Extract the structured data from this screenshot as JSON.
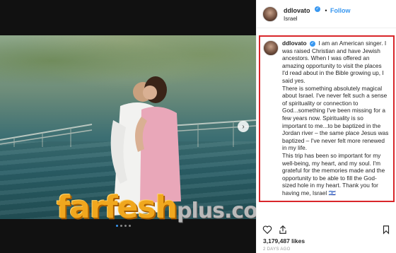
{
  "post": {
    "username": "ddlovato",
    "follow_label": "Follow",
    "separator": "•",
    "location": "Israel",
    "caption_username": "ddlovato",
    "caption_paragraphs": [
      "I am an American singer. I was raised Christian and have Jewish ancestors. When I was offered an amazing opportunity to visit the places I'd read about in the Bible growing up, I said yes.",
      "There is something absolutely magical about Israel.  I've never felt such a sense of spirituality or connection to God...something I've been missing for a few years now.  Spirituality is so important to me...to be baptized in the Jordan river – the same place Jesus was baptized – I've never felt more renewed in my life.",
      "This trip has been so important for my well-being, my heart, and my soul.  I'm grateful for the memories made and the opportunity to be able to fill the God-sized hole in my heart. Thank you for having me, Israel 🇮🇱"
    ],
    "likes": "3,179,487 likes",
    "date": "2 DAYS AGO",
    "verified_icon": "verified-badge-icon"
  },
  "photo": {
    "watermark_main": "farfesh",
    "watermark_plus": "plus",
    "watermark_domain": ".com",
    "carousel_dots": 4,
    "active_dot": 1
  },
  "colors": {
    "accent": "#3897f0",
    "highlight_border": "#d9262a",
    "watermark": "#f0a71e"
  }
}
